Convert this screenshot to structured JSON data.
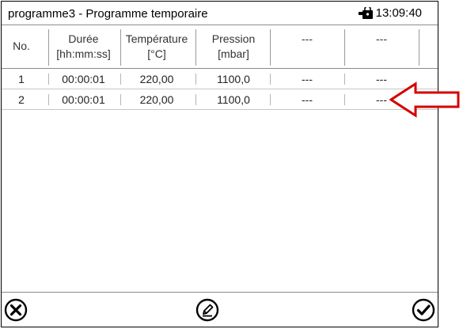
{
  "window": {
    "title": "programme3 - Programme temporaire",
    "time": "13:09:40",
    "lock_icon": "door-lock-icon"
  },
  "table": {
    "columns": [
      {
        "line1": "No.",
        "line2": ""
      },
      {
        "line1": "Durée",
        "line2": "[hh:mm:ss]"
      },
      {
        "line1": "Température",
        "line2": "[°C]"
      },
      {
        "line1": "Pression",
        "line2": "[mbar]"
      },
      {
        "line1": "---",
        "line2": ""
      },
      {
        "line1": "---",
        "line2": ""
      }
    ],
    "rows": [
      {
        "no": "1",
        "duree": "00:00:01",
        "temperature": "220,00",
        "pression": "1100,0",
        "c5": "---",
        "c6": "---"
      },
      {
        "no": "2",
        "duree": "00:00:01",
        "temperature": "220,00",
        "pression": "1100,0",
        "c5": "---",
        "c6": "---"
      }
    ]
  },
  "footer": {
    "cancel_icon": "cancel-circle-icon",
    "edit_icon": "edit-pencil-icon",
    "confirm_icon": "confirm-check-icon"
  },
  "annotation": {
    "arrow_color": "#d40000",
    "arrow_icon": "left-arrow-icon"
  }
}
